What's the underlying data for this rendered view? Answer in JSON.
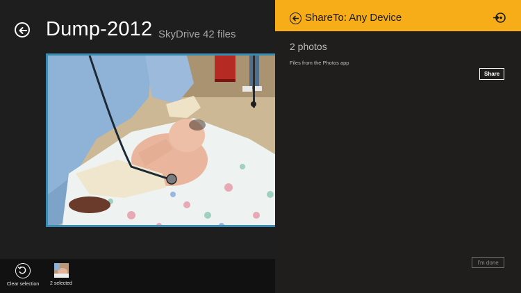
{
  "photos_app": {
    "album_title": "Dump-2012",
    "source": "SkyDrive",
    "file_count": "42 files",
    "app_bar": {
      "clear_selection_label": "Clear selection",
      "selected_label": "2 selected"
    }
  },
  "share_pane": {
    "title": "ShareTo: Any Device",
    "item_count": "2 photos",
    "description": "Files from the Photos app",
    "share_label": "Share",
    "done_label": "I'm done"
  },
  "colors": {
    "accent": "#f7ad18",
    "selection_border": "#3a8db0",
    "pane_background": "#201e1d",
    "app_background": "#1e1e1e"
  },
  "icons": {
    "back": "back-arrow-circle-icon",
    "device": "connect-devices-icon",
    "clear_selection": "undo-circle-icon"
  }
}
